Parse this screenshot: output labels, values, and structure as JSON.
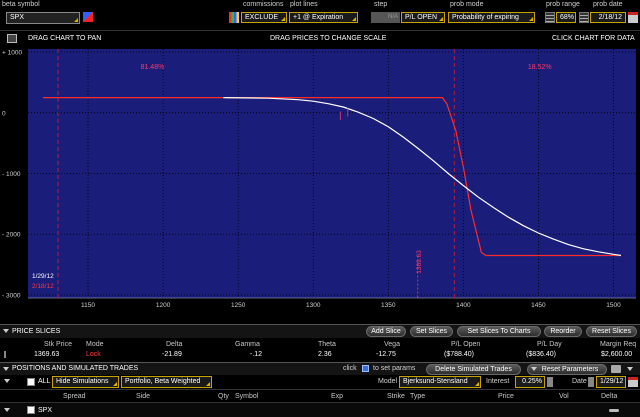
{
  "topbar": {
    "beta_symbol_label": "beta symbol",
    "symbol_value": "SPX",
    "commissions_label": "commissions",
    "commissions_value": "EXCLUDE",
    "plot_lines_label": "plot lines",
    "plot_lines_value": "+1 @ Expiration",
    "step_label": "step",
    "step_value": "N/A",
    "pnl_value": "P/L OPEN",
    "prob_mode_label": "prob mode",
    "prob_mode_value": "Probability of expiring",
    "prob_range_label": "prob range",
    "prob_range_value": "68%",
    "prob_date_label": "prob date",
    "prob_date_value": "2/18/12"
  },
  "chart_toolbar": {
    "drag_pan": "DRAG CHART TO PAN",
    "drag_prices": "DRAG PRICES TO CHANGE SCALE",
    "click_data": "CLICK CHART FOR DATA"
  },
  "chart_data": {
    "type": "line",
    "xlim": [
      1110,
      1515
    ],
    "ylim": [
      -3050,
      1050
    ],
    "x_ticks": [
      1150,
      1200,
      1250,
      1300,
      1350,
      1400,
      1450,
      1500
    ],
    "x_tick_labels": [
      "1150",
      "1200",
      "1250",
      "1300",
      "1350",
      "1400",
      "1450",
      "1500"
    ],
    "y_ticks": [
      1000,
      0,
      -1000,
      -2000,
      -3000
    ],
    "y_tick_labels": [
      "+ 1000",
      "0",
      "- 1000",
      "- 2000",
      "- 3000"
    ],
    "grid": true,
    "prob_left_label": "81.48%",
    "prob_right_label": "18.52%",
    "prob_bound_low": 1130,
    "prob_bound_high": 1394,
    "current_price": 1369.63,
    "current_price_label": "1369.63",
    "date_today": "1/29/12",
    "date_exp": "2/18/12",
    "series": [
      {
        "color": "#ff2a2a",
        "x": [
          1120,
          1386,
          1389,
          1395,
          1400,
          1405,
          1412,
          1415,
          1420,
          1440,
          1505
        ],
        "y": [
          250,
          250,
          150,
          -300,
          -900,
          -1600,
          -2300,
          -2350,
          -2350,
          -2350,
          -2350
        ]
      },
      {
        "color": "#ffffff",
        "x": [
          1240,
          1270,
          1290,
          1300,
          1310,
          1320,
          1330,
          1340,
          1350,
          1360,
          1370,
          1380,
          1390,
          1400,
          1410,
          1420,
          1430,
          1440,
          1450,
          1460,
          1470,
          1480,
          1490,
          1500,
          1505
        ],
        "y": [
          250,
          240,
          215,
          190,
          150,
          95,
          10,
          -95,
          -230,
          -400,
          -590,
          -790,
          -1000,
          -1200,
          -1390,
          -1560,
          -1720,
          -1860,
          -1980,
          -2080,
          -2170,
          -2240,
          -2290,
          -2330,
          -2350
        ]
      }
    ]
  },
  "price_slices": {
    "title": "PRICE SLICES",
    "buttons": [
      "Add Slice",
      "Set Slices",
      "Set Slices To Charts",
      "Reorder",
      "Reset Slices"
    ],
    "headers": [
      "Stk Price",
      "Mode",
      "Delta",
      "Gamma",
      "Theta",
      "Vega",
      "P/L Open",
      "P/L Day",
      "Margin Req"
    ],
    "values": [
      "1369.63",
      "Lock",
      "-21.89",
      "-.12",
      "2.36",
      "-12.75",
      "($788.40)",
      "($836.40)",
      "$2,600.00"
    ]
  },
  "positions": {
    "title": "POSITIONS AND SIMULATED TRADES",
    "click_text": "click",
    "to_set_params": "to set params",
    "delete_btn": "Delete Simulated Trades",
    "reset_btn": "Reset Parameters",
    "all_label": "ALL",
    "hide_sim": "Hide Simulations",
    "portfolio": "Portfolio, Beta Weighted",
    "model_label": "Model",
    "model_value": "Bjerksund-Stensland",
    "interest_label": "Interest",
    "interest_value": "0.25%",
    "date_label": "Date",
    "date_value": "1/29/12",
    "columns": [
      "Spread",
      "Side",
      "Qty",
      "Symbol",
      "Exp",
      "Strike",
      "Type",
      "Price",
      "Vol",
      "Delta"
    ],
    "row_symbol": "SPX"
  }
}
